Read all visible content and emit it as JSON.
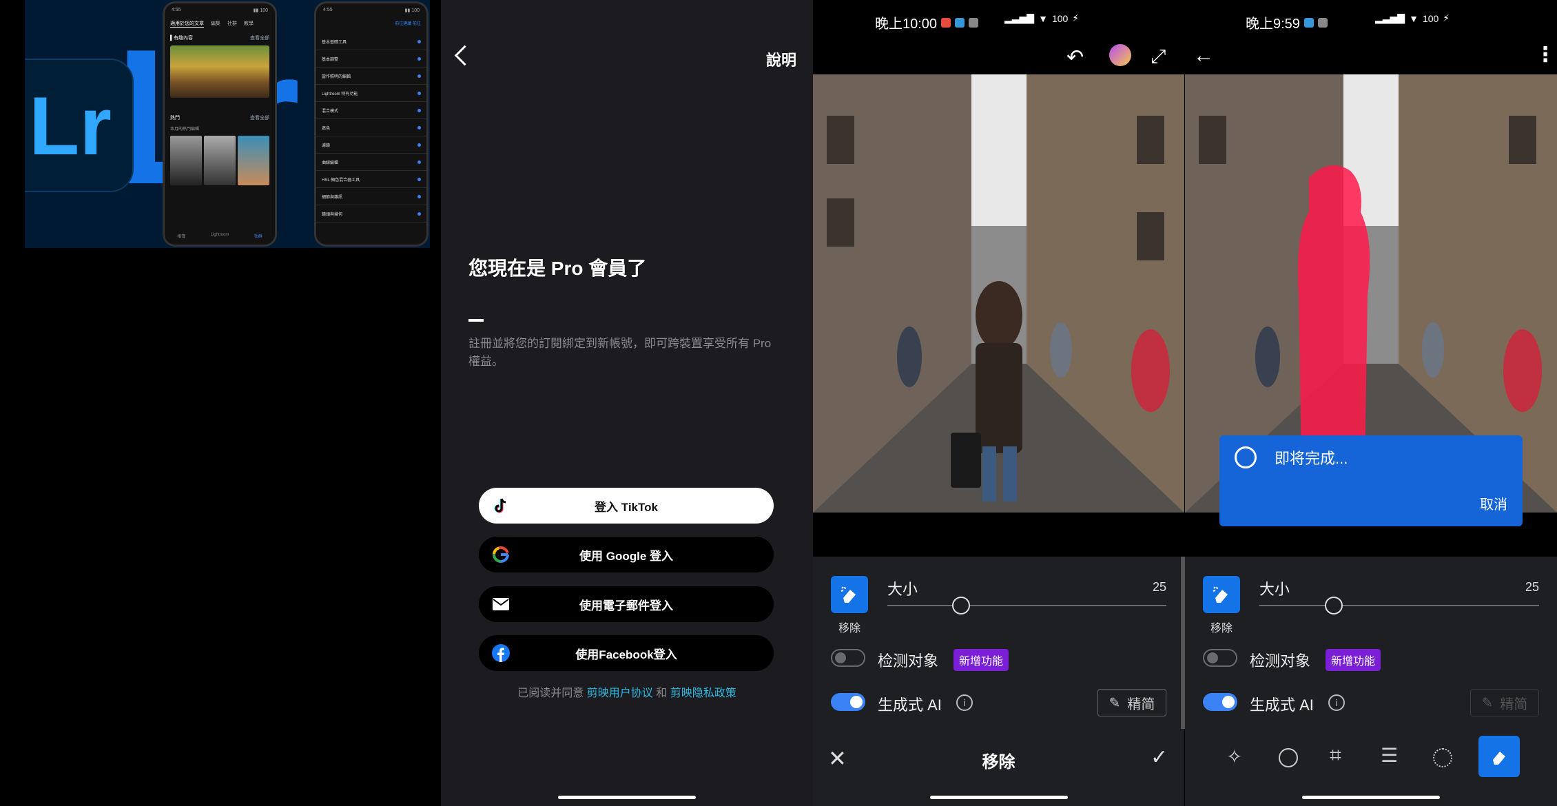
{
  "promo": {
    "logo_text": "Lr",
    "phone1": {
      "status_time": "4:55",
      "tabs": [
        "適用於您的文章",
        "編集",
        "社群",
        "教學",
        "探索"
      ],
      "section1_title": "▌有趣內容",
      "section1_link": "查看全部",
      "section2_title": "熱門",
      "section2_sub": "本月的熱門編輯",
      "section2_link": "查看全部",
      "nav": [
        "相簿",
        "Lightroom",
        "社群"
      ]
    },
    "phone2": {
      "status_time": "4:55",
      "header_links": [
        "前往建議",
        "前往"
      ],
      "rows": [
        "基本基礎工具",
        "基本調整",
        "當作照明的編輯",
        "Lightroom 特有功能",
        "混合模式",
        "遮色",
        "濾鏡",
        "曲線編輯",
        "HSL 顏色混合器工具",
        "細節與雜訊",
        "鏡頭與幾何"
      ]
    }
  },
  "pro_screen": {
    "help_label": "說明",
    "title": "您現在是 Pro 會員了",
    "description": "註冊並將您的訂閱綁定到新帳號，即可跨裝置享受所有 Pro 權益。",
    "buttons": [
      {
        "label": "登入 TikTok",
        "icon": "tiktok-icon"
      },
      {
        "label": "使用 Google 登入",
        "icon": "google-icon"
      },
      {
        "label": "使用電子郵件登入",
        "icon": "mail-icon"
      },
      {
        "label": "使用Facebook登入",
        "icon": "facebook-icon"
      }
    ],
    "terms_prefix": "已阅读并同意",
    "terms_link1": "剪映用户协议",
    "terms_and": "和",
    "terms_link2": "剪映隐私政策"
  },
  "editor_left": {
    "status_time": "晚上10:00",
    "status_right": "100",
    "tool_label": "移除",
    "size_label": "大小",
    "size_value": "25",
    "size_level": 0.26,
    "detect_label": "检测对象",
    "detect_on": false,
    "new_badge": "新增功能",
    "gen_ai_label": "生成式 AI",
    "gen_ai_on": true,
    "refine_label": "精简",
    "bottom_title": "移除"
  },
  "editor_right": {
    "status_time": "晚上9:59",
    "status_right": "100",
    "progress_text": "即将完成...",
    "cancel_label": "取消",
    "tool_label": "移除",
    "size_label": "大小",
    "size_value": "25",
    "size_level": 0.26,
    "detect_label": "检测对象",
    "detect_on": false,
    "new_badge": "新增功能",
    "gen_ai_label": "生成式 AI",
    "gen_ai_on": true,
    "refine_label": "精简",
    "toolbar_icons": [
      "magic-wand-icon",
      "masking-icon",
      "crop-icon",
      "adjust-icon",
      "vignette-icon",
      "eraser-icon"
    ]
  },
  "colors": {
    "accent": "#1473e6",
    "link": "#2fb7e0",
    "badge": "#7a1fd6",
    "mask": "#ff1a4a"
  }
}
